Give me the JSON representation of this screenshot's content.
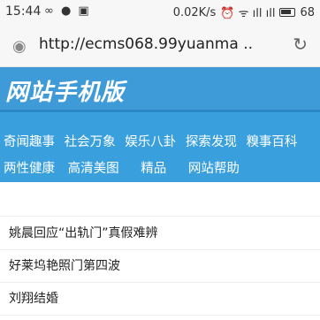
{
  "status_bar": {
    "time": "15:44",
    "left_icons": "∞ ● ▣",
    "data_rate": "0.02K/s",
    "icons": "⏰ ᯤ ıll ıll",
    "battery": "68"
  },
  "url_bar": {
    "url": "http://ecms068.99yuanma ..",
    "eye_icon": "eye-icon",
    "reload_icon": "reload-icon"
  },
  "header": {
    "logo": "网站手机版"
  },
  "nav": {
    "row1": [
      "奇闻趣事",
      "社会万象",
      "娱乐八卦",
      "探索发现",
      "糗事百科"
    ],
    "row2": [
      "两性健康",
      "高清美图",
      "精品",
      "网站帮助"
    ]
  },
  "list": {
    "items": [
      "姚晨回应“出轨门”真假难辨",
      "好莱坞艳照门第四波",
      "刘翔结婚"
    ]
  },
  "colors": {
    "header_bg": "#3f9ad8",
    "nav_bg": "#3aa0dd"
  }
}
